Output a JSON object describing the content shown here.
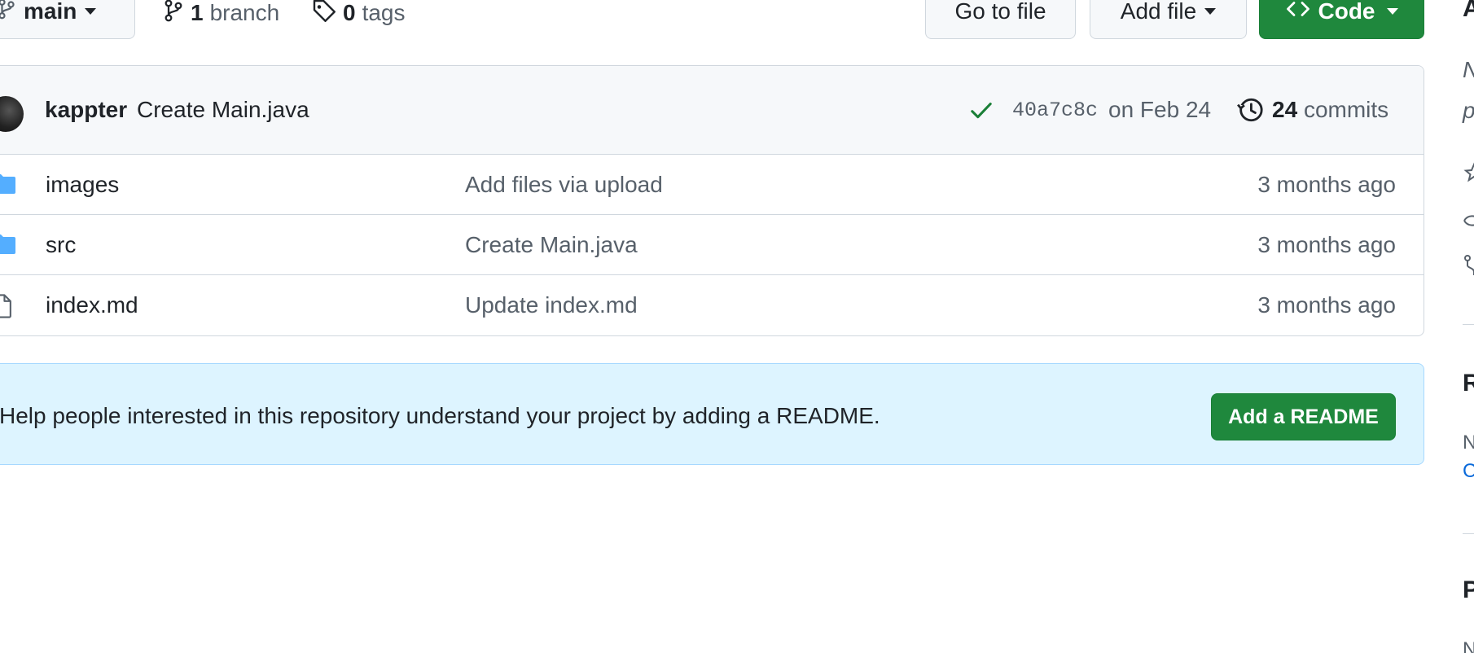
{
  "toolbar": {
    "branch_name": "main",
    "branch_count": "1",
    "branch_label": "branch",
    "tag_count": "0",
    "tag_label": "tags",
    "goto_file": "Go to file",
    "add_file": "Add file",
    "code": "Code"
  },
  "commit": {
    "author": "kappter",
    "message": "Create Main.java",
    "sha": "40a7c8c",
    "date": "on Feb 24",
    "count": "24",
    "count_label": "commits",
    "status": "success"
  },
  "files": [
    {
      "name": "images",
      "type": "folder",
      "message": "Add files via upload",
      "age": "3 months ago"
    },
    {
      "name": "src",
      "type": "folder",
      "message": "Create Main.java",
      "age": "3 months ago"
    },
    {
      "name": "index.md",
      "type": "file",
      "message": "Update index.md",
      "age": "3 months ago"
    }
  ],
  "readme": {
    "text": "Help people interested in this repository understand your project by adding a README.",
    "button": "Add a README"
  },
  "sidebar": {
    "fragments": [
      "A",
      "N",
      "p",
      "R",
      "N",
      "C",
      "P"
    ]
  },
  "colors": {
    "primary_button": "#1f883d",
    "folder_icon": "#54aeff",
    "banner_bg": "#ddf4ff",
    "success_check": "#1a7f37"
  }
}
